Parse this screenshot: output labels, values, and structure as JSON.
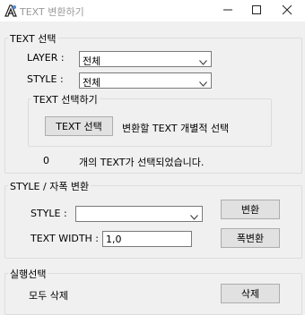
{
  "window": {
    "title": "TEXT 변환하기",
    "icons": {
      "app": "app-logo-icon",
      "minimize": "minimize-icon",
      "maximize": "maximize-icon",
      "close": "close-icon"
    }
  },
  "text_select": {
    "legend": "TEXT 선택",
    "layer_label": "LAYER :",
    "layer_value": "전체",
    "style_label": "STYLE :",
    "style_value": "전체",
    "sub_legend": "TEXT 선택하기",
    "select_button": "TEXT 선택",
    "select_hint": "변환할 TEXT 개별적 선택",
    "count": "0",
    "count_suffix": "개의 TEXT가 선택되었습니다."
  },
  "style_change": {
    "legend": "STYLE / 자폭 변환",
    "style_label": "STYLE :",
    "style_value": "",
    "convert_button": "변환",
    "width_label": "TEXT WIDTH :",
    "width_value": "1,0",
    "width_convert_button": "폭변환"
  },
  "execute": {
    "legend": "실행선택",
    "delete_all_label": "모두 삭제",
    "delete_button": "삭제"
  }
}
